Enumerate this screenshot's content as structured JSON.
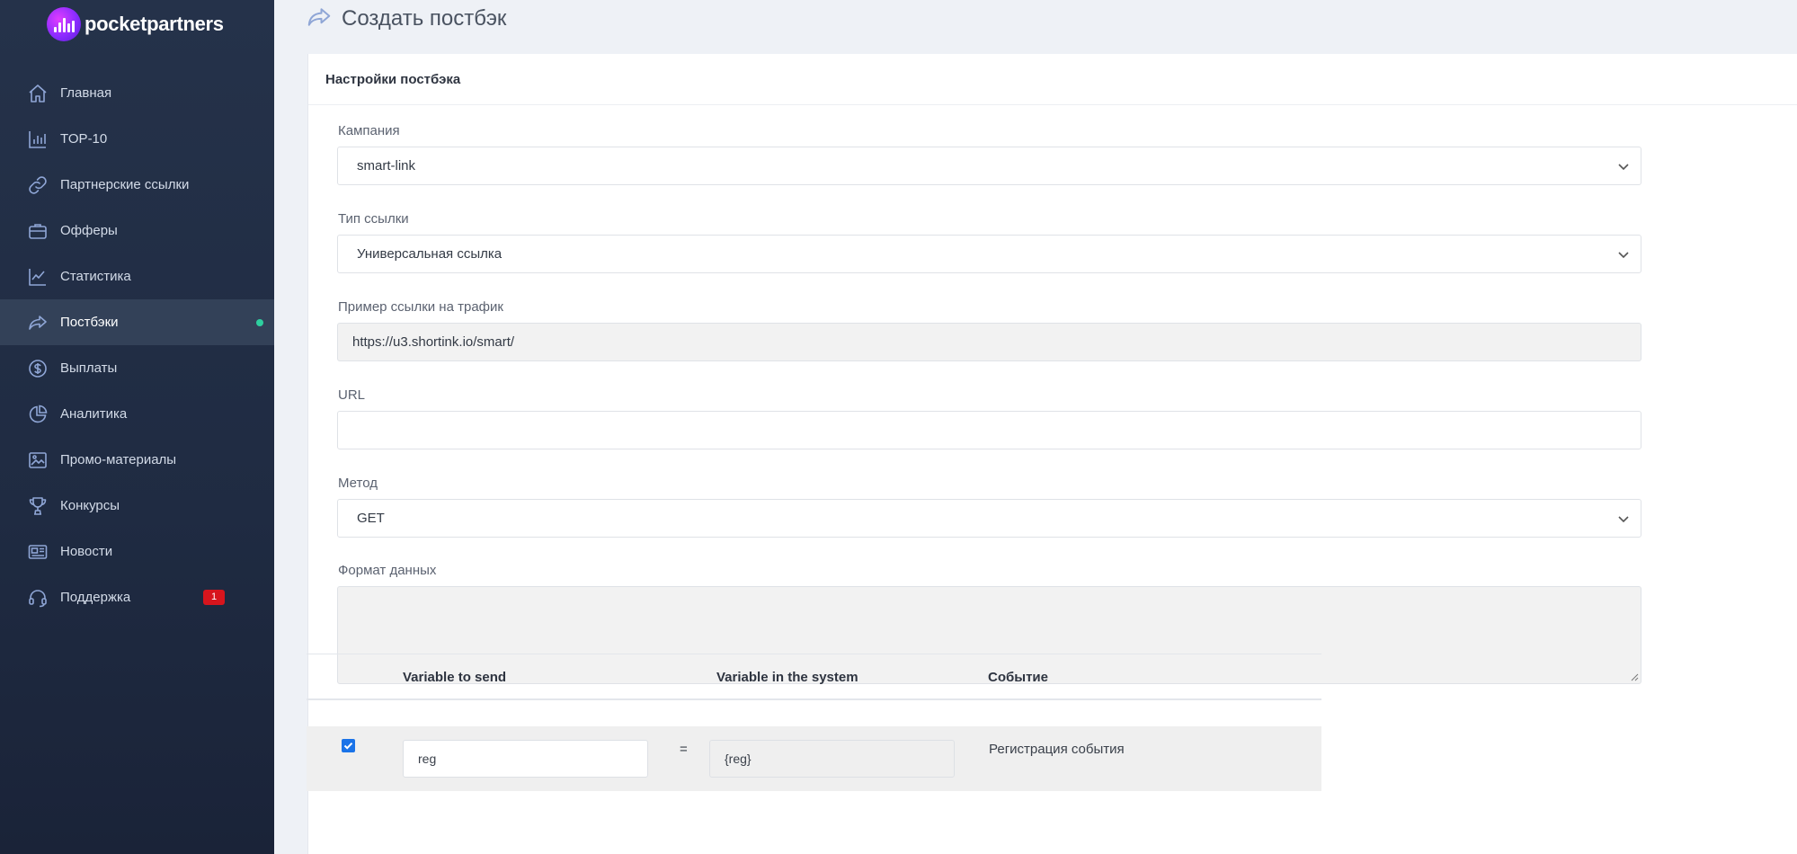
{
  "brand": {
    "name": "pocketpartners"
  },
  "sidebar": {
    "items": [
      {
        "label": "Главная",
        "icon": "home-icon"
      },
      {
        "label": "TOP-10",
        "icon": "bar-chart-icon"
      },
      {
        "label": "Партнерские ссылки",
        "icon": "link-icon"
      },
      {
        "label": "Офферы",
        "icon": "briefcase-icon"
      },
      {
        "label": "Статистика",
        "icon": "line-chart-icon"
      },
      {
        "label": "Постбэки",
        "icon": "share-arrow-icon",
        "active": true
      },
      {
        "label": "Выплаты",
        "icon": "dollar-coin-icon"
      },
      {
        "label": "Аналитика",
        "icon": "pie-chart-icon"
      },
      {
        "label": "Промо-материалы",
        "icon": "image-icon"
      },
      {
        "label": "Конкурсы",
        "icon": "trophy-icon"
      },
      {
        "label": "Новости",
        "icon": "newspaper-icon"
      },
      {
        "label": "Поддержка",
        "icon": "headset-icon",
        "badge": "1"
      }
    ],
    "active_dot_color": "#2ecf9f",
    "badge_color": "#d7151d"
  },
  "header": {
    "title": "Создать постбэк"
  },
  "form": {
    "card_title": "Настройки постбэка",
    "campaign": {
      "label": "Кампания",
      "value": "smart-link"
    },
    "link_type": {
      "label": "Тип ссылки",
      "value": "Универсальная ссылка"
    },
    "traffic_example": {
      "label": "Пример ссылки на трафик",
      "value": "https://u3.shortink.io/smart/"
    },
    "url": {
      "label": "URL",
      "value": ""
    },
    "method": {
      "label": "Метод",
      "value": "GET"
    },
    "data_format": {
      "label": "Формат данных",
      "value": ""
    }
  },
  "table": {
    "headers": {
      "variable_to_send": "Variable to send",
      "variable_in_system": "Variable in the system",
      "event": "Событие"
    },
    "rows": [
      {
        "checked": true,
        "variable_to_send": "reg",
        "equals": "=",
        "variable_in_system": "{reg}",
        "event": "Регистрация события"
      }
    ]
  }
}
